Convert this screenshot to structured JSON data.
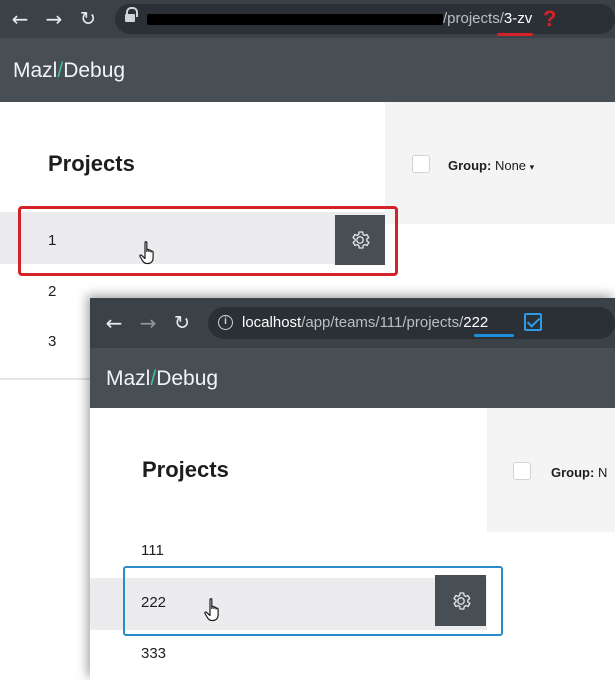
{
  "back_window": {
    "url_path": "/projects/",
    "url_highlight": "3-zv",
    "error_mark": "?",
    "brand_left": "Mazl",
    "brand_sep": "/",
    "brand_right": "Debug",
    "sidebar_title": "Projects",
    "group_label": "Group:",
    "group_value": "None",
    "projects": [
      "1",
      "2",
      "3"
    ],
    "selected_project": "1"
  },
  "front_window": {
    "url_host": "localhost",
    "url_path": "/app/teams/111/projects/",
    "url_highlight": "222",
    "brand_left": "Mazl",
    "brand_sep": "/",
    "brand_right": "Debug",
    "sidebar_title": "Projects",
    "group_label": "Group:",
    "group_value": "N",
    "projects": [
      "111",
      "222",
      "333"
    ],
    "selected_project": "222"
  },
  "icons": {
    "back": "←",
    "forward": "→",
    "reload": "↻",
    "caret": "▾"
  },
  "colors": {
    "highlight_back": "#d4222a",
    "highlight_front": "#2a8bc9",
    "brand_accent": "#3fbf9b",
    "appbar": "#474e54"
  }
}
